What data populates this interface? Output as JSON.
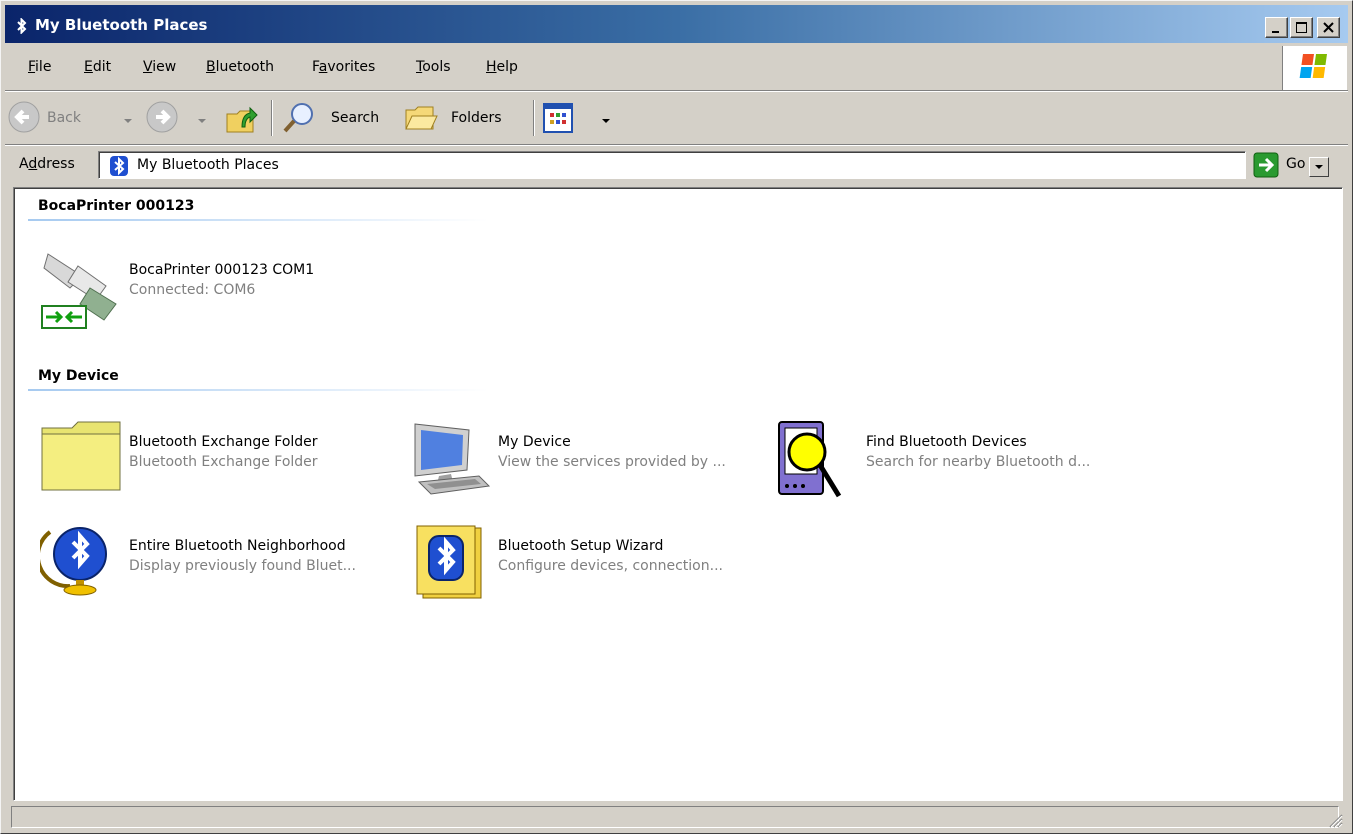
{
  "window": {
    "title": "My Bluetooth Places"
  },
  "menu": {
    "items": [
      {
        "pre": "",
        "key": "F",
        "post": "ile"
      },
      {
        "pre": "",
        "key": "E",
        "post": "dit"
      },
      {
        "pre": "",
        "key": "V",
        "post": "iew"
      },
      {
        "pre": "",
        "key": "B",
        "post": "luetooth"
      },
      {
        "pre": "F",
        "key": "a",
        "post": "vorites"
      },
      {
        "pre": "",
        "key": "T",
        "post": "ools"
      },
      {
        "pre": "",
        "key": "H",
        "post": "elp"
      }
    ]
  },
  "toolbar": {
    "back_label": "Back",
    "search_label": "Search",
    "folders_label": "Folders"
  },
  "address": {
    "label_pre": "A",
    "label_key": "d",
    "label_post": "dress",
    "value": "My Bluetooth Places",
    "go_label": "Go"
  },
  "groups": [
    {
      "header": "BocaPrinter 000123",
      "items": [
        {
          "name": "BocaPrinter 000123 COM1",
          "sub": "Connected: COM6",
          "icon": "serial-port-icon"
        }
      ]
    },
    {
      "header": "My Device",
      "items": [
        {
          "name": "Bluetooth Exchange Folder",
          "sub": "Bluetooth Exchange Folder",
          "icon": "folder-icon"
        },
        {
          "name": "My Device",
          "sub": "View the services provided by ...",
          "icon": "computer-icon"
        },
        {
          "name": "Find Bluetooth Devices",
          "sub": "Search for nearby Bluetooth d...",
          "icon": "find-devices-icon"
        },
        {
          "name": "Entire Bluetooth Neighborhood",
          "sub": "Display previously found Bluet...",
          "icon": "bluetooth-globe-icon"
        },
        {
          "name": "Bluetooth Setup Wizard",
          "sub": "Configure devices, connection...",
          "icon": "bluetooth-wizard-icon"
        }
      ]
    }
  ],
  "colors": {
    "title_gradient_start": "#0a246a",
    "title_gradient_end": "#a6caf0",
    "bluetooth_blue": "#1f4fd0",
    "face": "#d4d0c8"
  }
}
